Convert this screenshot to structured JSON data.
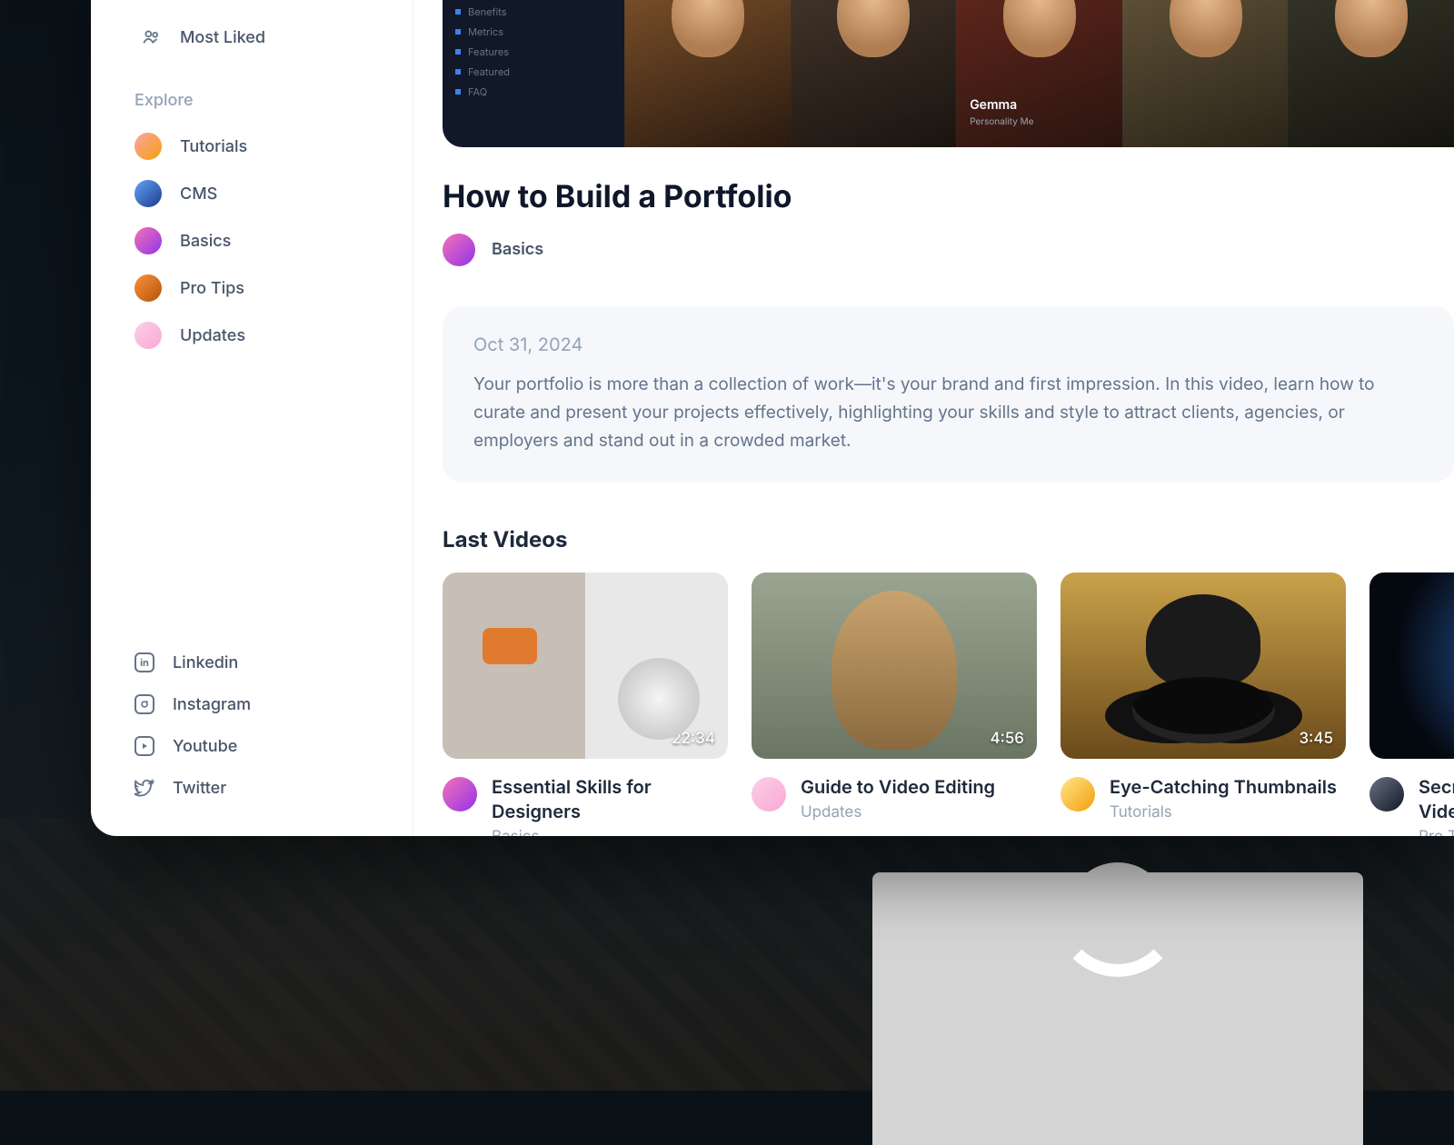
{
  "sidebar": {
    "top": [
      {
        "label": "Most Liked"
      }
    ],
    "explore_label": "Explore",
    "explore": [
      {
        "label": "Tutorials"
      },
      {
        "label": "CMS"
      },
      {
        "label": "Basics"
      },
      {
        "label": "Pro Tips"
      },
      {
        "label": "Updates"
      }
    ],
    "social": [
      {
        "label": "Linkedin"
      },
      {
        "label": "Instagram"
      },
      {
        "label": "Youtube"
      },
      {
        "label": "Twitter"
      }
    ]
  },
  "hero": {
    "face_name": "Gemma",
    "face_sub": "Personality Me"
  },
  "article": {
    "title": "How to Build a Portfolio",
    "category": "Basics",
    "date": "Oct 31, 2024",
    "body": "Your portfolio is more than a collection of work—it's your brand and first impression. In this video, learn how to curate and present your projects effectively, highlighting your skills and style to attract clients, agencies, or employers and stand out in a crowded market."
  },
  "last_videos": {
    "heading": "Last Videos",
    "items": [
      {
        "title": "Essential Skills for Designers",
        "category": "Basics",
        "duration": "22:34"
      },
      {
        "title": "Guide to Video Editing",
        "category": "Updates",
        "duration": "4:56"
      },
      {
        "title": "Eye-Catching Thumbnails",
        "category": "Tutorials",
        "duration": "3:45"
      },
      {
        "title": "Secrets of Cinematic Video",
        "category": "Pro Tips",
        "duration": ""
      }
    ]
  }
}
